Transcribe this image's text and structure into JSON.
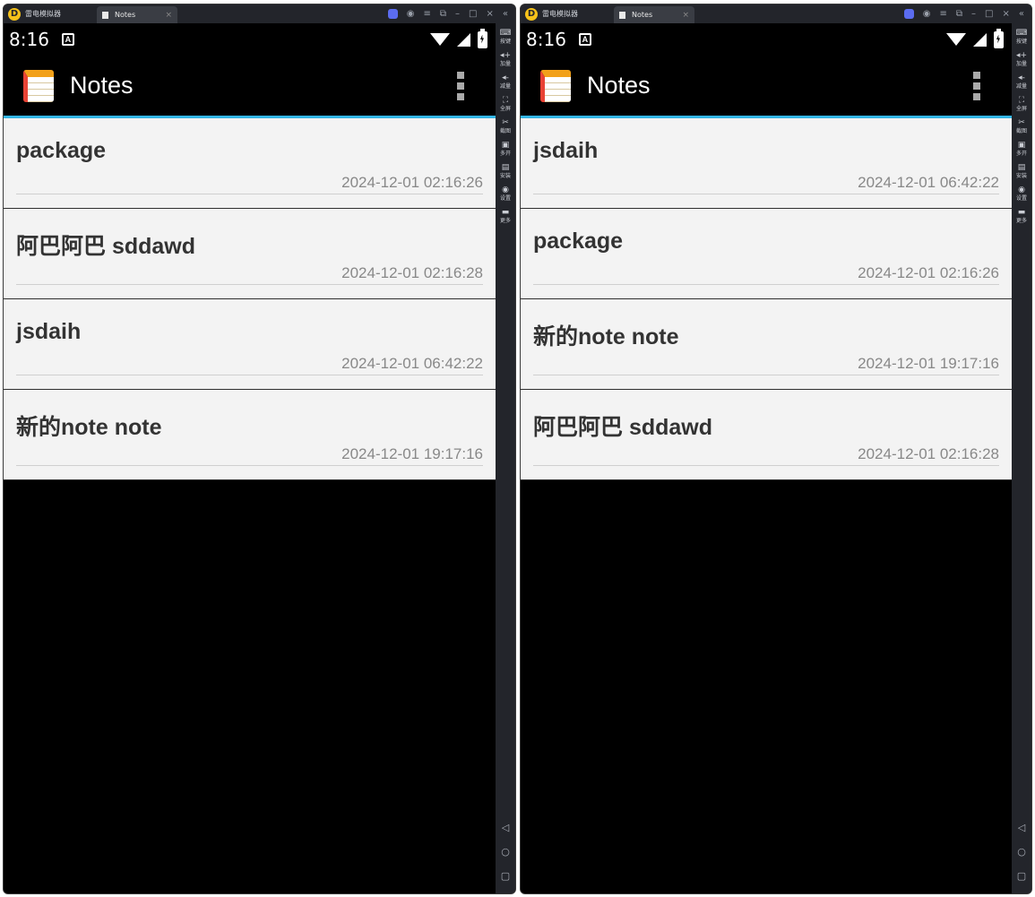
{
  "emulator": {
    "name": "雷电模拟器",
    "logo": "D",
    "tab_label": "Notes",
    "tab_close": "×",
    "controls": [
      "◉",
      "≡",
      "⧉",
      "–",
      "□",
      "×",
      "«"
    ],
    "sidebar": [
      {
        "icon": "keyboard-icon",
        "glyph": "⌨",
        "label": "按键"
      },
      {
        "icon": "volume-up-icon",
        "glyph": "◂+",
        "label": "加量"
      },
      {
        "icon": "volume-down-icon",
        "glyph": "◂-",
        "label": "减量"
      },
      {
        "icon": "fullscreen-icon",
        "glyph": "⛶",
        "label": "全屏"
      },
      {
        "icon": "screenshot-icon",
        "glyph": "✂",
        "label": "截图"
      },
      {
        "icon": "multi-instance-icon",
        "glyph": "▣",
        "label": "多开"
      },
      {
        "icon": "install-icon",
        "glyph": "▤",
        "label": "安装"
      },
      {
        "icon": "settings-icon",
        "glyph": "◉",
        "label": "设置"
      },
      {
        "icon": "more-icon",
        "glyph": "▬",
        "label": "更多"
      }
    ],
    "nav": [
      "◁",
      "○",
      "▢"
    ]
  },
  "status_bar": {
    "time": "8:16",
    "notification_icon": "A"
  },
  "app": {
    "title": "Notes"
  },
  "panes": [
    {
      "notes": [
        {
          "title": "package",
          "time": "2024-12-01 02:16:26"
        },
        {
          "title": "阿巴阿巴 sddawd",
          "time": "2024-12-01 02:16:28"
        },
        {
          "title": "jsdaih",
          "time": "2024-12-01 06:42:22"
        },
        {
          "title": "新的note note",
          "time": "2024-12-01 19:17:16"
        }
      ]
    },
    {
      "notes": [
        {
          "title": "jsdaih",
          "time": "2024-12-01 06:42:22"
        },
        {
          "title": "package",
          "time": "2024-12-01 02:16:26"
        },
        {
          "title": "新的note note",
          "time": "2024-12-01 19:17:16"
        },
        {
          "title": "阿巴阿巴 sddawd",
          "time": "2024-12-01 02:16:28"
        }
      ]
    }
  ],
  "colors": {
    "accent": "#33b5e5",
    "actionbar": "#000000",
    "list_bg": "#f3f3f3",
    "title_text": "#333333",
    "time_text": "#888888",
    "emulator_chrome": "#23252b"
  }
}
